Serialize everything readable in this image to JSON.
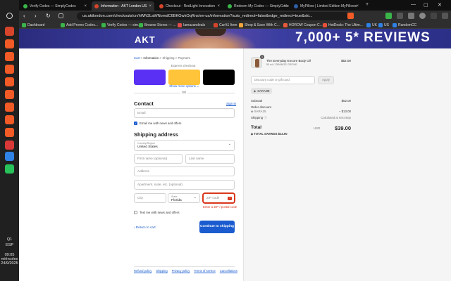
{
  "taskbar": {
    "icons": [
      "search-icon",
      "browser-icon",
      "brave-icon",
      "brave-icon",
      "brave-icon",
      "brave-icon",
      "brave-icon",
      "brave-icon",
      "brave-icon",
      "brave-icon",
      "grid-icon",
      "vpn-icon",
      "whatsapp-icon"
    ],
    "colors": [
      "#e9e9e9",
      "#d6452a",
      "#f25a26",
      "#f25a26",
      "#f25a26",
      "#f25a26",
      "#f25a26",
      "#f25a26",
      "#f25a26",
      "#f25a26",
      "#d93838",
      "#2f82e6",
      "#27c25a"
    ],
    "clock": {
      "lang": "ESP",
      "time": "09:05",
      "day": "miércoles",
      "date": "24/9/2025"
    },
    "notif_count": "Q1"
  },
  "tabs": [
    {
      "label": "Verify Codes — SimplyCodes",
      "color": "#3bb54a",
      "active": false
    },
    {
      "label": "Information - AKT London US",
      "color": "#d6452a",
      "active": true
    },
    {
      "label": "Checkout - RedLight Innovation",
      "color": "#d6452a",
      "active": false
    },
    {
      "label": "Redeem My Codes — SimplyCodes",
      "color": "#3bb54a",
      "active": false
    },
    {
      "label": "MyPillow | Limited Edition MyPillows",
      "color": "#2f5fa8",
      "active": false
    }
  ],
  "window_controls": {
    "minimize": "—",
    "maximize": "▢",
    "close": "✕"
  },
  "nav": {
    "back": "‹",
    "forward": "›",
    "reload": "↻",
    "url": "us.aktlondon.com/checkouts/cn/hWN3LaWNomdC6BKGwkOqRns/en-us/information?auto_redirect=false&edge_redirect=true&ski..."
  },
  "bookmarks": [
    {
      "label": "Dashboard",
      "color": "#3bb54a"
    },
    {
      "label": "Add Promo Codes...",
      "color": "#3bb54a"
    },
    {
      "label": "Verify Codes — sim...",
      "color": "#3bb54a"
    },
    {
      "label": "Browse Stores — ...",
      "color": "#3bb54a"
    },
    {
      "label": "Iamazandeals",
      "color": "#e14d4d"
    },
    {
      "label": "Can't1 Item",
      "color": "#d6452a"
    },
    {
      "label": "Shop & Save With C...",
      "color": "#f2a53a"
    },
    {
      "label": "HOROW Coupon C...",
      "color": "#e85a3c"
    },
    {
      "label": "HotDeals: The Ultim...",
      "color": "#e8503a"
    },
    {
      "label": "UK",
      "color": "#2f82e6"
    },
    {
      "label": "US",
      "color": "#2f82e6"
    },
    {
      "label": "RandomCC",
      "color": "#2f82e6"
    }
  ],
  "banner": {
    "left": "AKT",
    "right": "7,000+ 5* REVIEWS"
  },
  "breadcrumbs": {
    "cart": "Cart",
    "sep": ">",
    "information": "Information",
    "shipping": "Shipping",
    "payment": "Payment"
  },
  "express": {
    "label": "Express checkout",
    "more": "Show more options ⌄",
    "or": "OR"
  },
  "express_buttons": [
    {
      "color": "#5a31f4"
    },
    {
      "color": "#ffc439"
    },
    {
      "color": "#000000"
    }
  ],
  "contact": {
    "heading": "Contact",
    "signin": "Sign in",
    "email_placeholder": "Email",
    "news_label": "Email me with news and offers"
  },
  "shipping": {
    "heading": "Shipping address",
    "country_label": "Country/Region",
    "country_value": "United States",
    "first_name": "First name (optional)",
    "last_name": "Last name",
    "address": "Address",
    "apartment": "Apartment, suite, etc. (optional)",
    "city": "City",
    "state_label": "State",
    "state_value": "Florida",
    "zip": "ZIP code",
    "zip_error": "Enter a ZIP / postal code",
    "text_label": "Text me with news and offers"
  },
  "actions": {
    "return": "‹  Return to cart",
    "continue": "Continue to shipping"
  },
  "footer": [
    "Refund policy",
    "Shipping",
    "Privacy policy",
    "Terms of service",
    "Cancellations"
  ],
  "summary": {
    "qty": "1",
    "product_name": "The Everyday Encore Body Oil",
    "variant": "50 ml / ORANGE GROVE",
    "price": "$52.00",
    "discount_placeholder": "Discount code or gift card",
    "apply": "Apply",
    "code": "SARA25",
    "subtotal_label": "Subtotal",
    "subtotal_value": "$52.00",
    "order_discount_label": "Order discount",
    "discount_code_label": "SARA25",
    "discount_value": "− $13.00",
    "shipping_label": "Shipping",
    "shipping_value": "Calculated at next step",
    "total_label": "Total",
    "currency": "USD",
    "total_value": "$39.00",
    "savings": "TOTAL SAVINGS  $13.00"
  }
}
